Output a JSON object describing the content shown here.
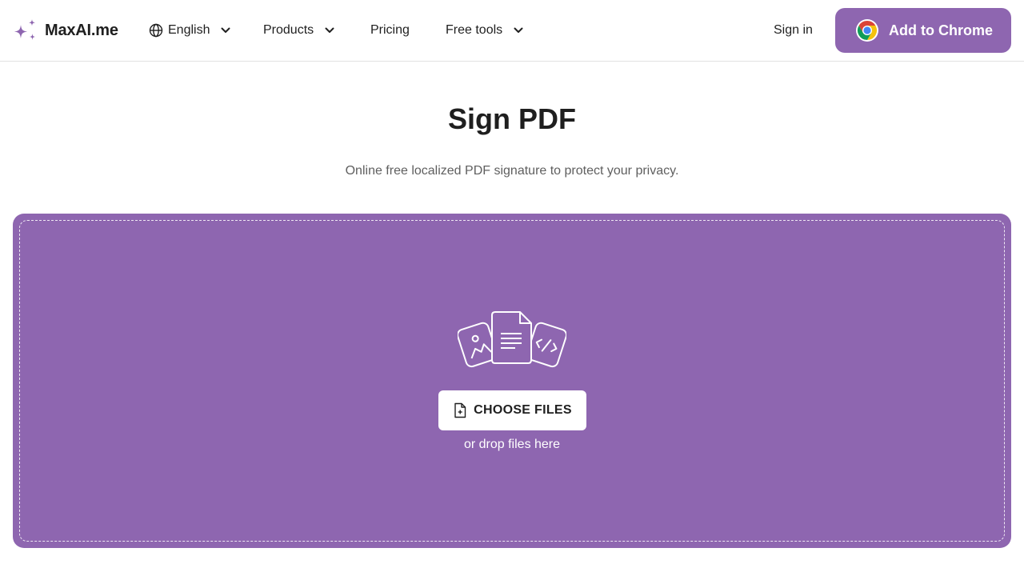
{
  "brand": {
    "name": "MaxAI.me",
    "accent_color": "#8e66b0"
  },
  "header": {
    "language": {
      "label": "English",
      "icon": "globe-icon"
    },
    "nav": {
      "products": "Products",
      "pricing": "Pricing",
      "free_tools": "Free tools"
    },
    "sign_in": "Sign in",
    "cta": {
      "label": "Add to Chrome",
      "icon": "chrome-icon"
    }
  },
  "main": {
    "title": "Sign PDF",
    "subtitle": "Online free localized PDF signature to protect your privacy."
  },
  "dropzone": {
    "choose_button": "CHOOSE FILES",
    "drop_hint": "or drop files here",
    "icons": [
      "image-file-icon",
      "document-file-icon",
      "code-file-icon",
      "file-add-icon"
    ]
  }
}
